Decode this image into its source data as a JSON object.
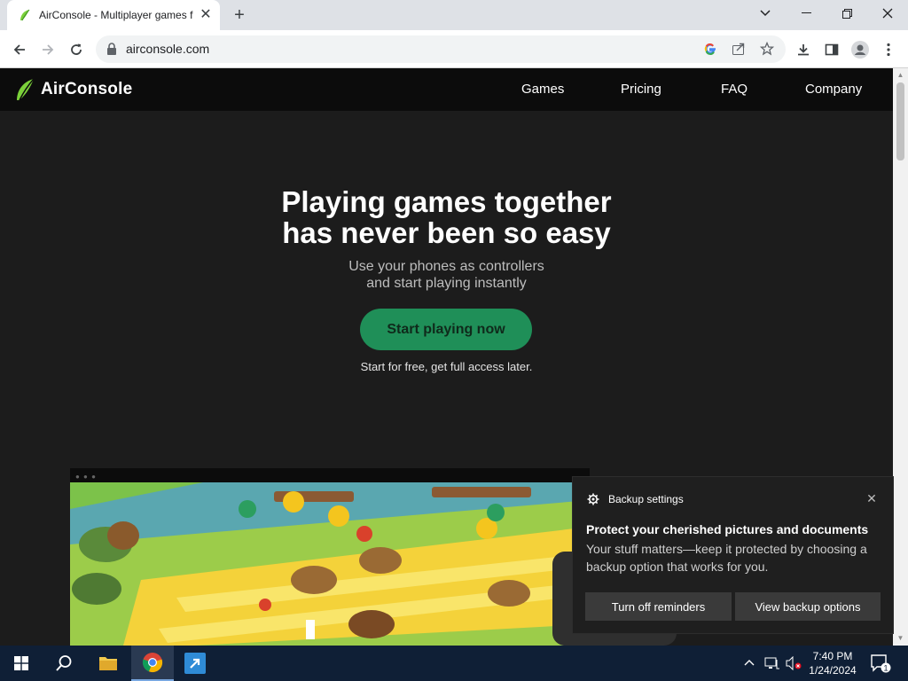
{
  "browser": {
    "tab_title": "AirConsole - Multiplayer games f",
    "url": "airconsole.com"
  },
  "site": {
    "brand": "AirConsole",
    "nav": [
      "Games",
      "Pricing",
      "FAQ",
      "Company"
    ],
    "hero": {
      "title_line1": "Playing games together",
      "title_line2": "has never been so easy",
      "sub_line1": "Use your phones as controllers",
      "sub_line2": "and start playing instantly",
      "cta": "Start playing now",
      "cta_note": "Start for free, get full access later."
    }
  },
  "notification": {
    "app": "Backup settings",
    "title": "Protect your cherished pictures and documents",
    "body": "Your stuff matters—keep it protected by choosing a backup option that works for you.",
    "button_dismiss": "Turn off reminders",
    "button_view": "View backup options"
  },
  "taskbar": {
    "time": "7:40 PM",
    "date": "1/24/2024",
    "notification_count": "1"
  },
  "colors": {
    "brand_green": "#1f8f58",
    "page_bg": "#1c1c1c",
    "taskbar_bg": "#0f1f36"
  }
}
